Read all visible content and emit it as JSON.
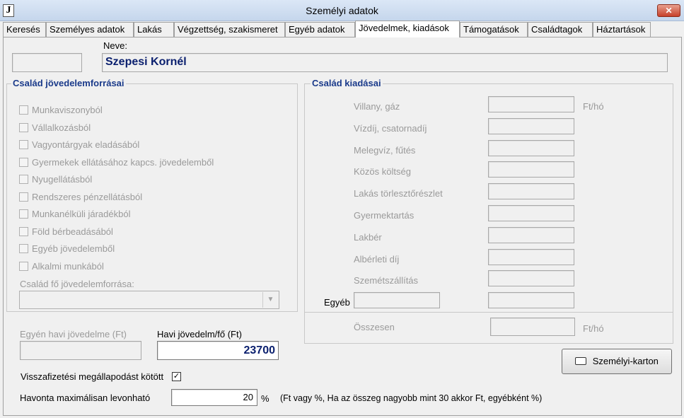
{
  "window": {
    "icon_letter": "J",
    "title": "Személyi adatok",
    "close_glyph": "✕"
  },
  "tabs": [
    {
      "label": "Keresés"
    },
    {
      "label": "Személyes adatok"
    },
    {
      "label": "Lakás"
    },
    {
      "label": "Végzettség, szakismeret"
    },
    {
      "label": "Egyéb adatok"
    },
    {
      "label": "Jövedelmek, kiadások"
    },
    {
      "label": "Támogatások"
    },
    {
      "label": "Családtagok"
    },
    {
      "label": "Háztartások"
    }
  ],
  "active_tab": "Jövedelmek, kiadások",
  "person": {
    "name_label": "Neve:",
    "name_value": "Szepesi Kornél",
    "id_value": ""
  },
  "income": {
    "title": "Család jövedelemforrásai",
    "checkboxes": [
      {
        "label": "Munkaviszonyból"
      },
      {
        "label": "Vállalkozásból"
      },
      {
        "label": "Vagyontárgyak eladásából"
      },
      {
        "label": "Gyermekek ellátásához kapcs. jövedelemből"
      },
      {
        "label": "Nyugellátásból"
      },
      {
        "label": "Rendszeres pénzellátásból"
      },
      {
        "label": "Munkanélküli járadékból"
      },
      {
        "label": "Föld bérbeadásából"
      },
      {
        "label": "Egyéb jövedelemből"
      },
      {
        "label": "Alkalmi munkából"
      }
    ],
    "main_source_label": "Család fő jövedelemforrása:",
    "main_source_value": "",
    "combo_arrow": "▼"
  },
  "expenses": {
    "title": "Család kiadásai",
    "items": [
      {
        "label": "Villany, gáz"
      },
      {
        "label": "Vízdíj, csatornadíj"
      },
      {
        "label": "Melegvíz, fűtés"
      },
      {
        "label": "Közös költség"
      },
      {
        "label": "Lakás törlesztőrészlet"
      },
      {
        "label": "Gyermektartás"
      },
      {
        "label": "Lakbér"
      },
      {
        "label": "Albérleti díj"
      },
      {
        "label": "Szemétszállítás"
      }
    ],
    "unit": "Ft/hó",
    "other_label": "Egyéb",
    "total_label": "Összesen",
    "total_unit": "Ft/hó"
  },
  "bottom": {
    "individual_income_label": "Egyén havi jövedelme (Ft)",
    "individual_income_value": "",
    "per_capita_label": "Havi jövedelm/fő (Ft)",
    "per_capita_value": "23700",
    "repayment_label": "Visszafizetési megállapodást kötött",
    "repayment_checked": "✓",
    "max_deduct_label": "Havonta maximálisan levonható",
    "max_deduct_value": "20",
    "max_deduct_unit": "%",
    "max_deduct_hint": "(Ft vagy %, Ha az összeg nagyobb mint 30 akkor Ft, egyébként %)",
    "card_button_label": "Személyi-karton",
    "card_button_icon": "printer-icon"
  },
  "colors": {
    "accent_blue": "#1a3a8a",
    "name_blue": "#0a1f6e",
    "disabled_text": "#9a9a9a"
  }
}
